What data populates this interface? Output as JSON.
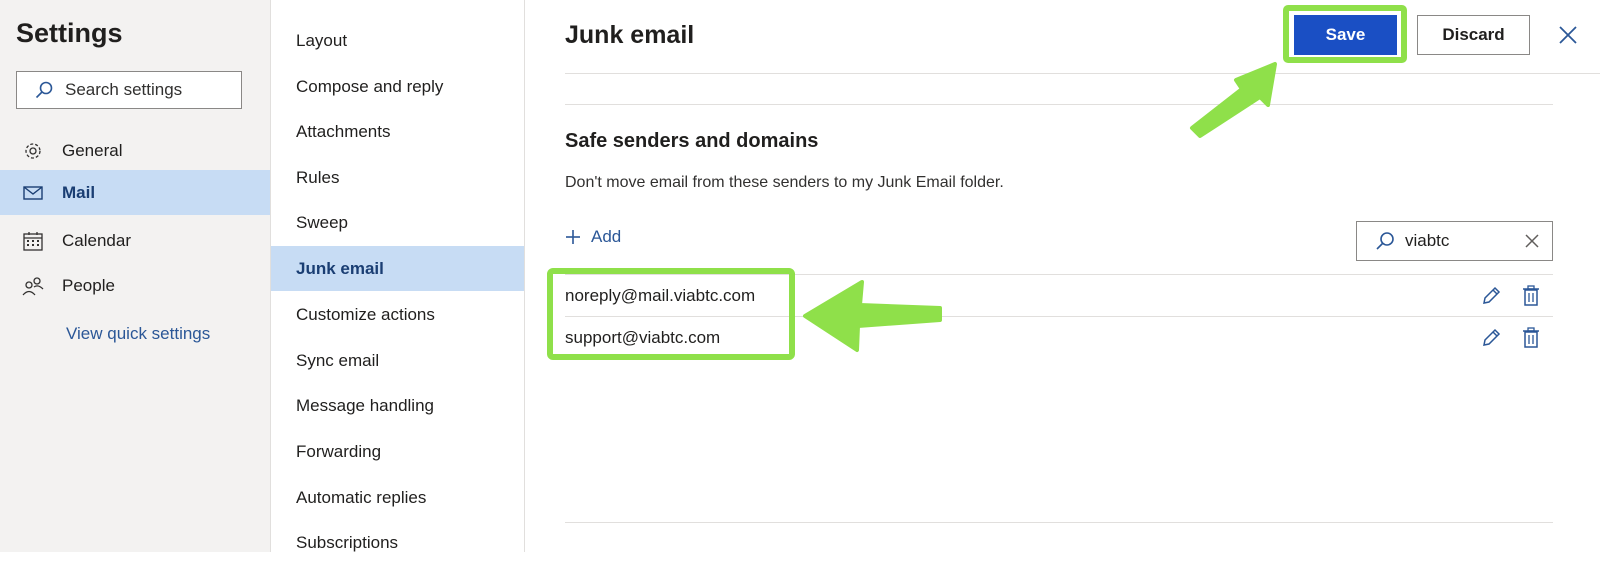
{
  "settings": {
    "title": "Settings",
    "search_placeholder": "Search settings",
    "nav": [
      {
        "label": "General",
        "icon": "gear-icon"
      },
      {
        "label": "Mail",
        "icon": "mail-icon"
      },
      {
        "label": "Calendar",
        "icon": "calendar-icon"
      },
      {
        "label": "People",
        "icon": "people-icon"
      }
    ],
    "selected_nav": "Mail",
    "quick_settings_link": "View quick settings"
  },
  "menu": {
    "items": [
      "Layout",
      "Compose and reply",
      "Attachments",
      "Rules",
      "Sweep",
      "Junk email",
      "Customize actions",
      "Sync email",
      "Message handling",
      "Forwarding",
      "Automatic replies",
      "Subscriptions"
    ],
    "selected": "Junk email"
  },
  "content": {
    "title": "Junk email",
    "save_label": "Save",
    "discard_label": "Discard",
    "section_title": "Safe senders and domains",
    "section_desc": "Don't move email from these senders to my Junk Email folder.",
    "add_label": "Add",
    "filter_value": "viabtc",
    "senders": [
      "noreply@mail.viabtc.com",
      "support@viabtc.com"
    ]
  },
  "colors": {
    "accent": "#1a4fc4",
    "selected_bg": "#c7dcf4",
    "link": "#2b5797",
    "highlight": "#8fe04a"
  }
}
